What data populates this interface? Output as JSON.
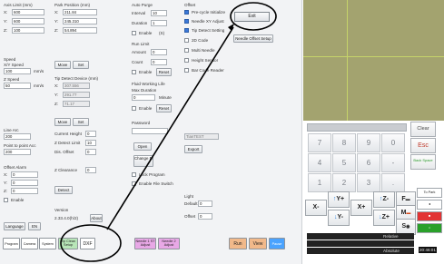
{
  "axis_limit": {
    "title": "Axis Limit (mm)",
    "x_label": "X:",
    "x_value": "600",
    "y_label": "Y:",
    "y_value": "600",
    "z_label": "Z:",
    "z_value": "100"
  },
  "park_position": {
    "title": "Park Position (mm)",
    "x_label": "X:",
    "x_value": "211.84",
    "y_label": "Y:",
    "y_value": "245.310",
    "z_label": "Z:",
    "z_value": "54.894",
    "move_label": "Move",
    "set_label": "Set"
  },
  "auto_purge": {
    "title": "Auto Purge",
    "interval_label": "Interval",
    "interval_value": "10",
    "duration_label": "Duration",
    "duration_value": "1",
    "enable_label": "Enable",
    "enable_suffix": "(S)"
  },
  "run_limit": {
    "title": "Run Limit",
    "amount_label": "Amount",
    "amount_value": "0",
    "count_label": "Count",
    "count_value": "0",
    "enable_label": "Enable",
    "reset_label": "Reset"
  },
  "fluid_working_life": {
    "title": "Fluid Working Life",
    "max_duration_label": "Max Duration",
    "value": "0",
    "unit": "Minute",
    "enable_label": "Enable",
    "reset_label": "Reset"
  },
  "password": {
    "label": "Password"
  },
  "open_label": "Open",
  "change_password_label": "Change Password",
  "lock_program_label": "Lock Program",
  "enable_file_switch_label": "Enable File Switch",
  "speed": {
    "title": "Speed",
    "xy_speed_label": "X/Y Speed",
    "xy_speed_value": "100",
    "xy_speed_unit": "mm/s",
    "z_speed_label": "Z Speed",
    "z_speed_value": "50",
    "z_speed_unit": "mm/s"
  },
  "tip_detect": {
    "title": "Tip Detect Device (mm)",
    "x_label": "X:",
    "x_value": "307.556",
    "y_label": "Y:",
    "y_value": "291.77",
    "z_label": "Z:",
    "z_value": "71.17",
    "move_label": "Move",
    "set_label": "Set"
  },
  "current_height_label": "Current Height",
  "current_height_value": "0",
  "z_detect_limit_label": "Z Detect Limit",
  "z_detect_limit_value": "10",
  "dis_offset_label": "Dis. Offset",
  "dis_offset_value": "0",
  "z_clearance_label": "Z Clearance",
  "z_clearance_value": "0",
  "detect_label": "Detect",
  "line_arc": {
    "title": "Line Arc",
    "value": "200"
  },
  "point_to_point": {
    "title": "Point to point Acc",
    "value": "200"
  },
  "offset_alarm": {
    "title": "Offset Alarm",
    "x_label": "X:",
    "x_value": "0",
    "y_label": "Y:",
    "y_value": "0",
    "z_label": "Z:",
    "z_value": "0",
    "enable_label": "Enable"
  },
  "offset": {
    "title": "Offset",
    "pre_cycle_label": "Pre-cycle Initialize",
    "needle_label": "Needle XY Adjust",
    "tip_detect_label": "Tip Detect Setting",
    "two_d_code_label": "2D Code",
    "multi_needle_label": "Multi Needle",
    "height_sensor_label": "Height Sensor",
    "bar_code_label": "Bar Code Reader"
  },
  "exit_label": "Exit",
  "needle_setup_label": "Needle Offset Setup",
  "printer_value": "TianTEST",
  "export_label": "Export",
  "light": {
    "title": "Light",
    "default_label": "Default",
    "default_value": "0",
    "offset_label": "Offset",
    "offset_value": "0"
  },
  "language_label": "Language",
  "language_value": "EN",
  "version_label": "Version",
  "version_value": "2.33.4.0(h/2)",
  "about_label": "About",
  "bottom_bar": {
    "program": "Program",
    "camera": "Camera",
    "system": "System",
    "tip_clean": "Tip Clean Setup",
    "dxf": "DXF",
    "needle1": "Needle 1 ST Adjust",
    "needle2": "Needle 2 Adjust",
    "run": "Run",
    "view": "View",
    "pause": "Pause"
  },
  "keypad": {
    "clear": "Clear",
    "esc": "Esc",
    "back_space": "Back Space",
    "keys": [
      "7",
      "8",
      "9",
      "0",
      "4",
      "5",
      "6",
      "-",
      "1",
      "2",
      "3",
      "."
    ]
  },
  "jog": {
    "xminus": "X-",
    "yplus": "Y+",
    "xplus": "X+",
    "zminus": "Z-",
    "yminus": "Y-",
    "zplus": "Z+",
    "f": "F",
    "m": "M",
    "s": "S"
  },
  "status": {
    "relative": "Relative",
    "absolute": "Absolute",
    "time": "20:46:01"
  },
  "side": {
    "to_park": "To Park",
    "home": "Home"
  },
  "colors": {
    "accent": "#3b78d8",
    "tip_clean": "#b8e6b8",
    "needle": "#e8a8e6",
    "run": "#f2b98a",
    "pause": "#4aa3ff",
    "red": "#e23333"
  }
}
